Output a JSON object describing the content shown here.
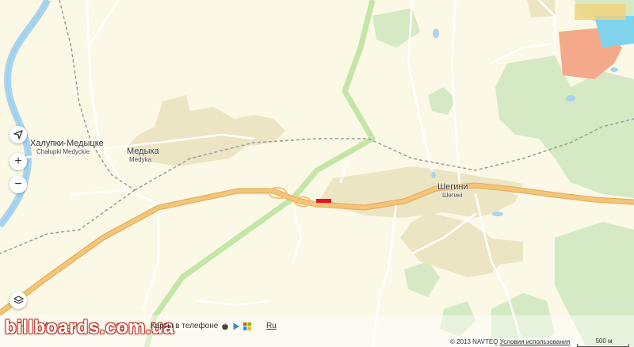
{
  "places": {
    "chalupki_ru": "Халупки-Медыцке",
    "chalupki_pl": "Chałupki Medyckie",
    "medyka_ru": "Медыка",
    "medyka_pl": "Medyka",
    "shehyni_ru": "Шегини",
    "shehyni_ua": "Шегині"
  },
  "controls": {
    "locate_icon": "navigation-arrow-icon",
    "zoom_in": "+",
    "zoom_out": "−",
    "layers_icon": "layers-icon"
  },
  "footer": {
    "brand": "billboards.com.ua",
    "tool_icons": [
      "ruler-icon",
      "route-icon",
      "car-icon",
      "share-icon",
      "print-icon"
    ],
    "phone_label": "Карты в телефоне",
    "store_icons": [
      "apple-icon",
      "play-icon",
      "windows-icon"
    ],
    "language": "Ru",
    "copyright": "© 2013 NAVTEQ",
    "terms": "Условия использования",
    "scale": "500 м"
  },
  "colors": {
    "background": "#fbf8e6",
    "road": "#f4c477",
    "road_edge": "#e3a85a",
    "river": "#a8d4ee",
    "forest": "#d5e9c4",
    "urban": "#ece5c3",
    "border": "#bde3a0",
    "marker": "#e0141e",
    "industrial": "#f3a98a"
  }
}
